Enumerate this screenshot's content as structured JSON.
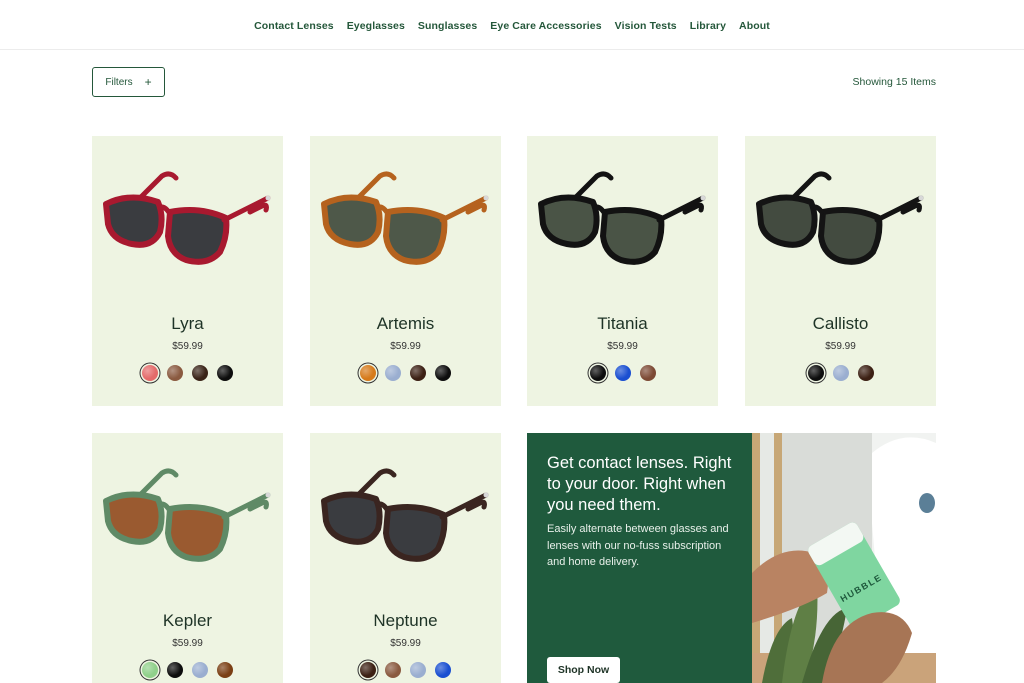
{
  "nav": {
    "items": [
      "Contact Lenses",
      "Eyeglasses",
      "Sunglasses",
      "Eye Care Accessories",
      "Vision Tests",
      "Library",
      "About"
    ]
  },
  "toolbar": {
    "filters_label": "Filters",
    "filters_icon": "+",
    "count_label": "Showing 15 Items"
  },
  "products": [
    {
      "name": "Lyra",
      "price": "$59.99",
      "frame_color": "#a8192f",
      "lens_color": "#3a3c40",
      "swatches": [
        "#e46a6a",
        "#8a5a40",
        "#3a2418",
        "#0d0d0d"
      ],
      "selected": 0
    },
    {
      "name": "Artemis",
      "price": "$59.99",
      "frame_color": "#b5621e",
      "lens_color": "#4e5849",
      "swatches": [
        "#d67a1a",
        "#9aaed0",
        "#3c2014",
        "#0d0d0d"
      ],
      "selected": 0
    },
    {
      "name": "Titania",
      "price": "$59.99",
      "frame_color": "#121212",
      "lens_color": "#4a5446",
      "swatches": [
        "#0d0d0d",
        "#1a4fd1",
        "#7d4a35"
      ],
      "selected": 0
    },
    {
      "name": "Callisto",
      "price": "$59.99",
      "frame_color": "#141414",
      "lens_color": "#434b40",
      "swatches": [
        "#0d0d0d",
        "#9aaed0",
        "#3c2014"
      ],
      "selected": 0
    },
    {
      "name": "Kepler",
      "price": "$59.99",
      "frame_color": "#5f8a66",
      "lens_color": "#9a5a30",
      "swatches": [
        "#8fd08a",
        "#0d0d0d",
        "#9aaed0",
        "#7a3f14"
      ],
      "selected": 0
    },
    {
      "name": "Neptune",
      "price": "$59.99",
      "frame_color": "#3a2520",
      "lens_color": "#3a3c40",
      "swatches": [
        "#3c2014",
        "#8a5a40",
        "#9aaed0",
        "#1a4fd1"
      ],
      "selected": 0
    }
  ],
  "promo": {
    "headline": "Get contact lenses. Right to your door. Right when you need them.",
    "body": "Easily alternate between glasses and lenses with our no-fuss subscription and home delivery.",
    "cta": "Shop Now",
    "box_text": "HUBBLE",
    "bg_color": "#1f5a3d"
  }
}
